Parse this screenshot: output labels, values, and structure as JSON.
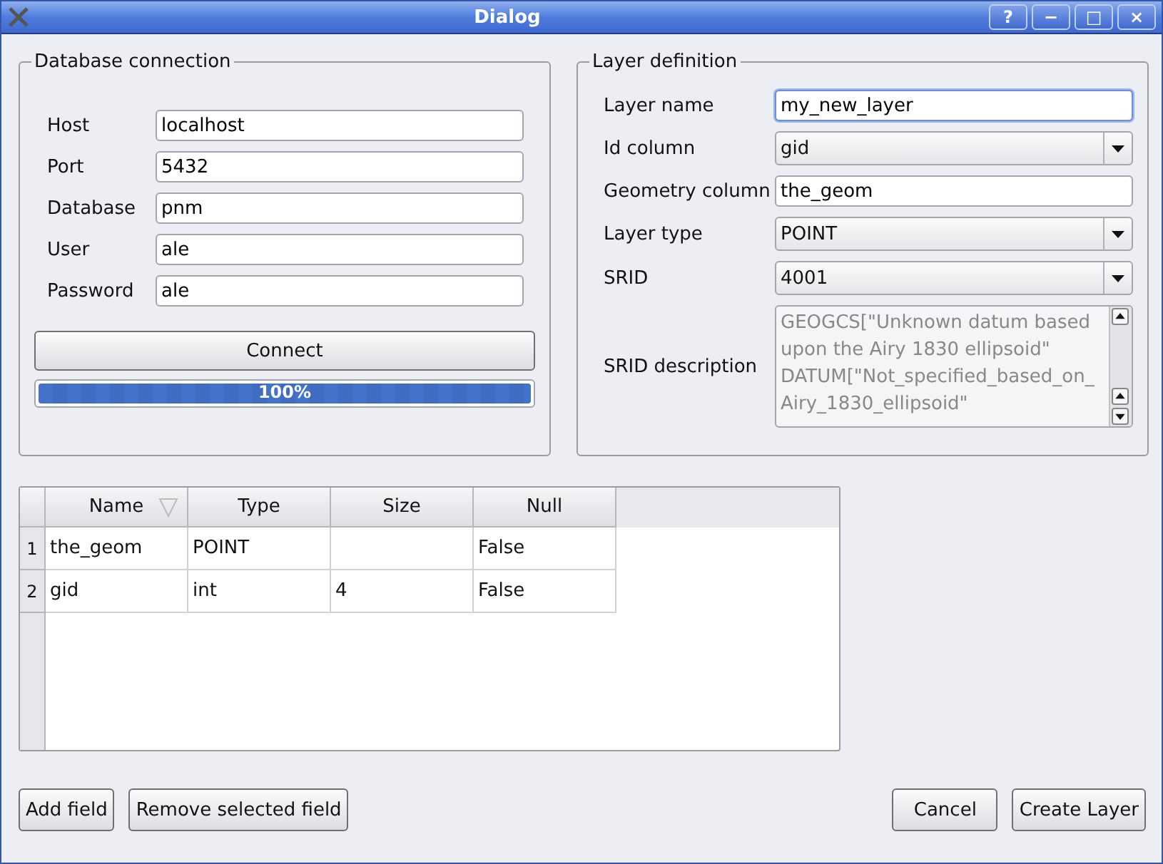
{
  "window": {
    "title": "Dialog",
    "controls": [
      "?",
      "−",
      "□",
      "×"
    ]
  },
  "database_connection": {
    "title": "Database connection",
    "fields": [
      {
        "label": "Host",
        "value": "localhost"
      },
      {
        "label": "Port",
        "value": "5432"
      },
      {
        "label": "Database",
        "value": "pnm"
      },
      {
        "label": "User",
        "value": "ale"
      },
      {
        "label": "Password",
        "value": "ale"
      }
    ],
    "connect_button": "Connect",
    "progress": {
      "level": 1,
      "reading": "100%"
    }
  },
  "layer_definition": {
    "title": "Layer definition",
    "fields": [
      {
        "kind": "text",
        "label": "Layer name",
        "value": "my_new_layer",
        "focused": true
      },
      {
        "kind": "combo",
        "label": "Id column",
        "value": "gid"
      },
      {
        "kind": "text",
        "label": "Geometry column",
        "value": "the_geom",
        "focused": false
      },
      {
        "kind": "combo",
        "label": "Layer type",
        "value": "POINT"
      },
      {
        "kind": "combo",
        "label": "SRID",
        "value": "4001"
      },
      {
        "kind": "textarea",
        "label": "SRID description",
        "lines": [
          "GEOGCS[\"Unknown datum based",
          "upon the Airy 1830 ellipsoid\"",
          "DATUM[\"Not_specified_based_on_",
          "Airy_1830_ellipsoid\""
        ]
      }
    ]
  },
  "table": {
    "columns": [
      {
        "label": "Name",
        "sorted": true
      },
      {
        "label": "Type",
        "sorted": false
      },
      {
        "label": "Size",
        "sorted": false
      },
      {
        "label": "Null",
        "sorted": false
      }
    ],
    "rows": [
      {
        "number": "1",
        "cells": [
          "the_geom",
          "POINT",
          "",
          "False"
        ]
      },
      {
        "number": "2",
        "cells": [
          "gid",
          "int",
          "4",
          "False"
        ]
      }
    ]
  },
  "buttons_left": [
    "Add field",
    "Remove selected field"
  ],
  "buttons_right": [
    "Cancel",
    "Create Layer"
  ]
}
